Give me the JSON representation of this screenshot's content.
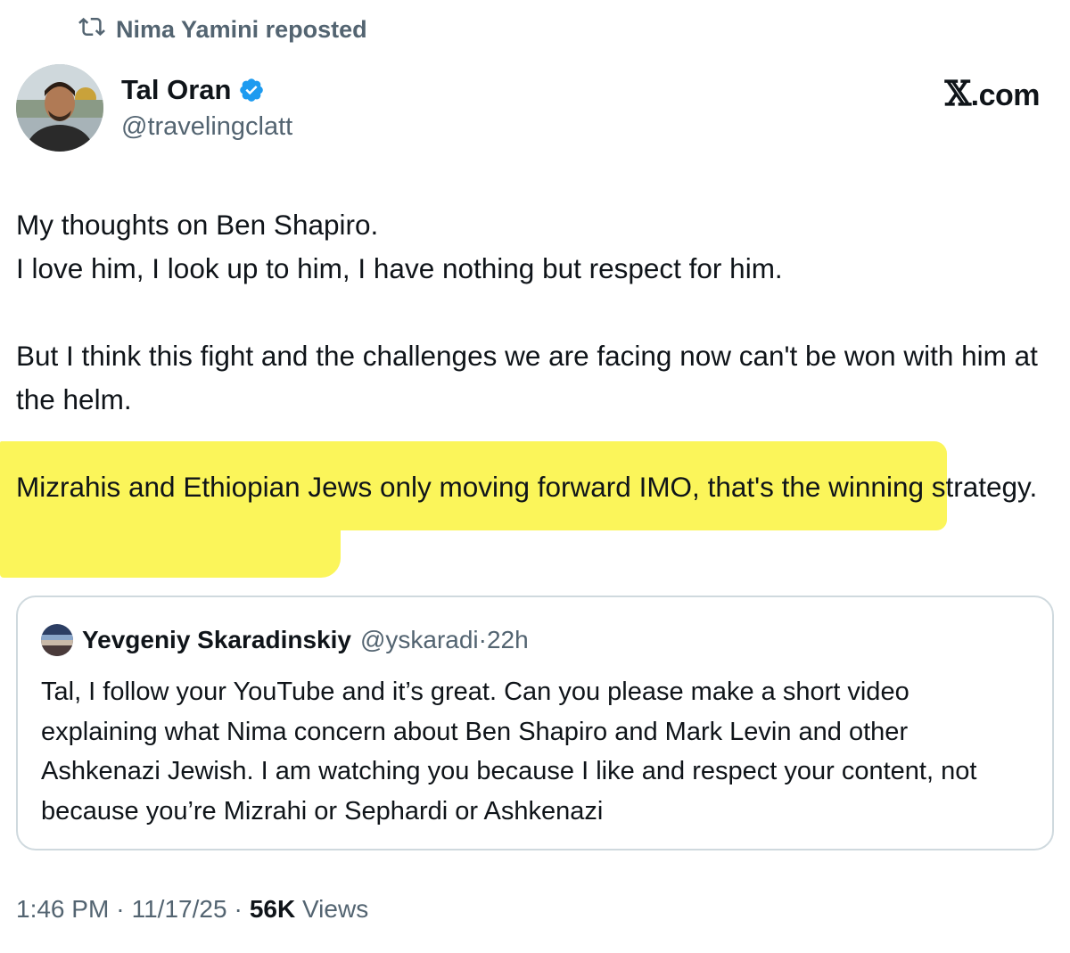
{
  "repost": {
    "text": "Nima Yamini reposted"
  },
  "author": {
    "name": "Tal Oran",
    "handle": "@travelingclatt",
    "verified": true
  },
  "watermark": {
    "x": "𝕏",
    "text": ".com"
  },
  "post": {
    "lines": [
      "My thoughts on Ben Shapiro.",
      "I love him, I look up to him, I have nothing but respect for him.",
      "But I think this fight and the challenges we are facing now can't be won with him at the helm.",
      "Mizrahis and Ethiopian Jews only moving forward IMO, that's the winning strategy."
    ]
  },
  "quote": {
    "name": "Yevgeniy Skaradinskiy",
    "handle": "@yskaradi",
    "sep": "·",
    "time": "22h",
    "text": "Tal, I follow your YouTube and it’s great. Can you please make a short video explaining what Nima concern about Ben Shapiro and Mark Levin and other Ashkenazi Jewish. I am watching you because I like and respect your content, not because you’re Mizrahi or Sephardi or Ashkenazi"
  },
  "meta": {
    "time": "1:46 PM",
    "sep1": "·",
    "date": "11/17/25",
    "sep2": "·",
    "views_count": "56K",
    "views_label": "Views"
  },
  "colors": {
    "highlight": "#fbf55a",
    "verified": "#1d9bf0",
    "muted": "#536471"
  },
  "icons": {
    "repost": "repost-icon",
    "verified": "verified-badge-icon"
  }
}
